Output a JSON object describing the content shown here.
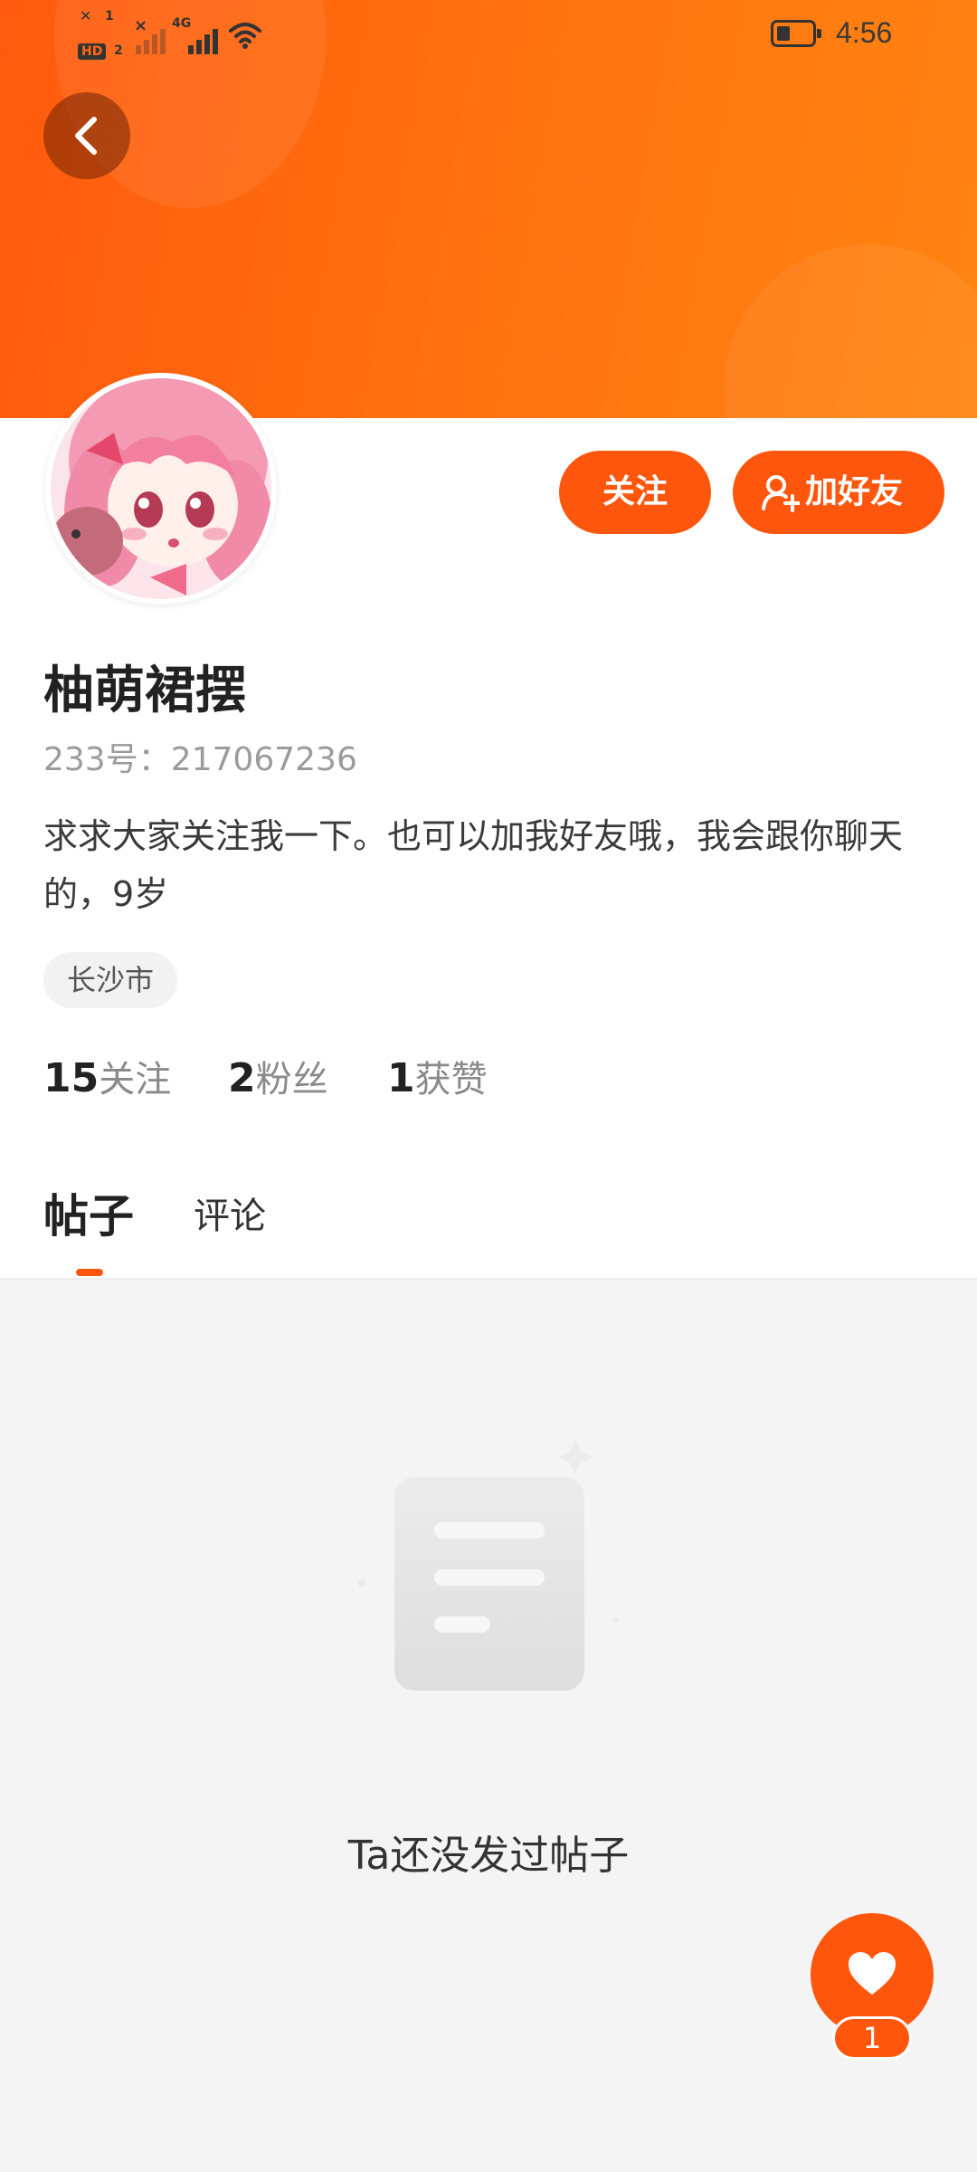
{
  "status_bar": {
    "time": "4:56",
    "network": "4G",
    "hd_badge": "HD",
    "sim1": "1",
    "sim2": "2",
    "signal_x": "×"
  },
  "header": {
    "back_icon": "chevron-left-icon"
  },
  "profile": {
    "username": "柚萌裙摆",
    "uid_text": "233号：217067236",
    "bio": "求求大家关注我一下。也可以加我好友哦，我会跟你聊天的，9岁",
    "location": "长沙市",
    "follow_label": "关注",
    "add_friend_label": "加好友",
    "add_friend_icon": "add-user-icon",
    "stats": [
      {
        "num": "15",
        "label": "关注"
      },
      {
        "num": "2",
        "label": "粉丝"
      },
      {
        "num": "1",
        "label": "获赞"
      }
    ]
  },
  "tabs": [
    {
      "label": "帖子",
      "active": true
    },
    {
      "label": "评论",
      "active": false
    }
  ],
  "empty_state": {
    "message": "Ta还没发过帖子",
    "icon": "empty-document-icon"
  },
  "fab": {
    "icon": "heart-icon",
    "count": "1"
  },
  "colors": {
    "accent": "#ff560d",
    "banner_start": "#ff5a0d",
    "banner_end": "#ff8512",
    "background": "#f4f4f4"
  }
}
